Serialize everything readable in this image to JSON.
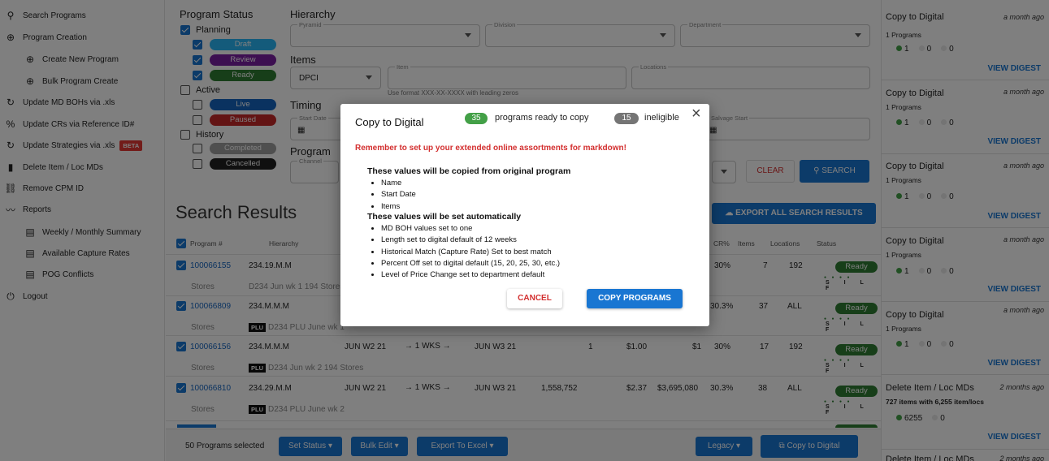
{
  "sidebar": {
    "items": [
      {
        "label": "Search Programs",
        "icon": "search-icon"
      },
      {
        "label": "Program Creation",
        "icon": "plus-circle-icon"
      },
      {
        "label": "Create New Program",
        "icon": "plus-circle-icon"
      },
      {
        "label": "Bulk Program Create",
        "icon": "plus-circle-icon"
      },
      {
        "label": "Update MD BOHs via .xls",
        "icon": "refresh-icon"
      },
      {
        "label": "Update CRs via Reference ID#",
        "icon": "percent-icon"
      },
      {
        "label": "Update Strategies via .xls",
        "icon": "refresh-icon",
        "badge": "BETA"
      },
      {
        "label": "Delete Item / Loc MDs",
        "icon": "trash-icon"
      },
      {
        "label": "Remove CPM ID",
        "icon": "link-off-icon"
      },
      {
        "label": "Reports",
        "icon": "chart-line-icon"
      },
      {
        "label": "Weekly / Monthly Summary",
        "icon": "document-icon"
      },
      {
        "label": "Available Capture Rates",
        "icon": "document-icon"
      },
      {
        "label": "POG Conflicts",
        "icon": "document-icon"
      },
      {
        "label": "Logout",
        "icon": "power-icon"
      }
    ]
  },
  "filters": {
    "program_status_title": "Program Status",
    "planning": "Planning",
    "draft": "Draft",
    "review": "Review",
    "ready": "Ready",
    "active": "Active",
    "live": "Live",
    "paused": "Paused",
    "history": "History",
    "completed": "Completed",
    "cancelled": "Cancelled",
    "hierarchy_title": "Hierarchy",
    "pyramid": "Pyramid",
    "division": "Division",
    "department": "Department",
    "items_title": "Items",
    "dpci": "DPCI",
    "item": "Item",
    "locations": "Locations",
    "item_hint": "Use format XXX-XX-XXXX with leading zeros",
    "timing_title": "Timing",
    "start_date": "Start Date",
    "salvage_start": "Salvage Start",
    "program_title": "Program",
    "channel": "Channel",
    "clear": "CLEAR",
    "search": "SEARCH"
  },
  "results": {
    "title": "Search Results",
    "export": "EXPORT ALL SEARCH RESULTS",
    "headers": {
      "program": "Program #",
      "hierarchy": "Hierarchy",
      "cr": "CR%",
      "items": "Items",
      "locations": "Locations",
      "status": "Status"
    },
    "rows": [
      {
        "id": "100066155",
        "hier": "234.19.M.M",
        "start": "",
        "arrow": "",
        "end": "",
        "qty": "",
        "price": "",
        "total": "",
        "cr": "30%",
        "items": "7",
        "locs": "192",
        "status": "Ready",
        "sub": "D234 Jun wk 1 194 Stores",
        "plu": false
      },
      {
        "id": "100066809",
        "hier": "234.M.M.M",
        "start": "",
        "arrow": "",
        "end": "",
        "qty": "",
        "price": "",
        "total": "",
        "cr": "30.3%",
        "items": "37",
        "locs": "ALL",
        "status": "Ready",
        "sub": "D234 PLU June wk 1",
        "plu": true
      },
      {
        "id": "100066156",
        "hier": "234.M.M.M",
        "start": "JUN W2 21",
        "arrow": "→ 1 WKS →",
        "end": "JUN W3 21",
        "qty": "1",
        "price": "$1.00",
        "total": "$1",
        "cr": "30%",
        "items": "17",
        "locs": "192",
        "status": "Ready",
        "sub": "D234 Jun wk 2 194 Stores",
        "plu": true
      },
      {
        "id": "100066810",
        "hier": "234.29.M.M",
        "start": "JUN W2 21",
        "arrow": "→ 1 WKS →",
        "end": "JUN W3 21",
        "qty": "1,558,752",
        "price": "$2.37",
        "total": "$3,695,080",
        "cr": "30.3%",
        "items": "38",
        "locs": "ALL",
        "status": "Ready",
        "sub": "D234 PLU June wk 2",
        "plu": true
      }
    ],
    "stores_label": "Stores",
    "silf": "S I L F"
  },
  "bottom_bar": {
    "selected": "50 Programs selected",
    "set_status": "Set Status ▾",
    "bulk_edit": "Bulk Edit ▾",
    "export_excel": "Export To Excel ▾",
    "legacy": "Legacy ▾",
    "copy_digital": "Copy to Digital"
  },
  "right_panel": {
    "cards": [
      {
        "title": "Copy to Digital",
        "ago": "a month ago",
        "sub": "1 Programs",
        "a": "1",
        "b": "0",
        "c": "0",
        "link": "VIEW DIGEST"
      },
      {
        "title": "Copy to Digital",
        "ago": "a month ago",
        "sub": "1 Programs",
        "a": "1",
        "b": "0",
        "c": "0",
        "link": "VIEW DIGEST"
      },
      {
        "title": "Copy to Digital",
        "ago": "a month ago",
        "sub": "1 Programs",
        "a": "1",
        "b": "0",
        "c": "0",
        "link": "VIEW DIGEST"
      },
      {
        "title": "Copy to Digital",
        "ago": "a month ago",
        "sub": "1 Programs",
        "a": "1",
        "b": "0",
        "c": "0",
        "link": "VIEW DIGEST"
      },
      {
        "title": "Copy to Digital",
        "ago": "a month ago",
        "sub": "1 Programs",
        "a": "1",
        "b": "0",
        "c": "0",
        "link": "VIEW DIGEST"
      },
      {
        "title": "Delete Item / Loc MDs",
        "ago": "2 months ago",
        "sub": "727 items with 6,255 item/locs",
        "a": "6255",
        "b": "0",
        "c": "",
        "link": "VIEW DIGEST"
      },
      {
        "title": "Delete Item / Loc MDs",
        "ago": "2 months ago"
      }
    ]
  },
  "modal": {
    "title": "Copy to Digital",
    "ready_count": "35",
    "ready_text": "programs ready to copy",
    "ineligible_count": "15",
    "ineligible_text": "ineligible",
    "warning": "Remember to set up your extended online assortments for markdown!",
    "copied_heading": "These values will be copied from original program",
    "copied": [
      "Name",
      "Start Date",
      "Items"
    ],
    "auto_heading": "These values will be set automatically",
    "auto": [
      "MD BOH values set to one",
      "Length set to digital default of 12 weeks",
      "Historical Match (Capture Rate) Set to best match",
      "Percent Off set to digital default (15, 20, 25, 30, etc.)",
      "Level of Price Change set to department default"
    ],
    "cancel": "CANCEL",
    "copy": "COPY PROGRAMS"
  },
  "colors": {
    "primary": "#1976d2",
    "ready": "#2e7d32",
    "warning": "#d32f2f",
    "draft": "#29b6f6",
    "review": "#7b1fa2",
    "paused": "#c62828",
    "live": "#1565c0",
    "completed": "#9e9e9e",
    "cancelled": "#212121"
  }
}
